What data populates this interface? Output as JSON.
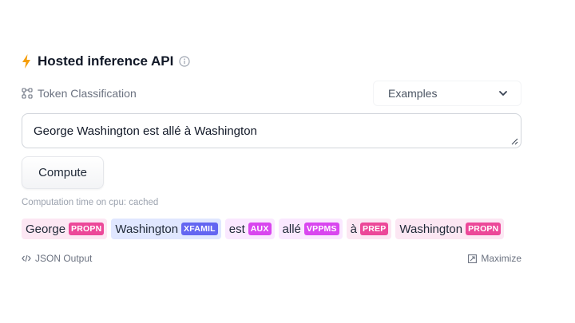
{
  "widget": {
    "title": "Hosted inference API",
    "task_label": "Token Classification",
    "examples_label": "Examples",
    "input_value": "George Washington est allé à Washington",
    "compute_label": "Compute",
    "computation_time": "Computation time on cpu: cached",
    "json_output_label": "JSON Output",
    "maximize_label": "Maximize",
    "icons": {
      "title": "lightning-icon",
      "info": "info-icon",
      "task": "token-classification-icon",
      "dropdown": "chevron-down-icon",
      "resize": "resize-handle-icon",
      "json": "code-icon",
      "maximize": "maximize-icon"
    }
  },
  "tokens": [
    {
      "word": "George",
      "label": "PROPN",
      "bg": "#fce7f3",
      "label_bg": "#ec4899",
      "text_color": "#1f2937"
    },
    {
      "word": "Washington",
      "label": "XFAMIL",
      "bg": "#e0e7ff",
      "label_bg": "#6366f1",
      "text_color": "#1f2937"
    },
    {
      "word": "est",
      "label": "AUX",
      "bg": "#fae8ff",
      "label_bg": "#d946ef",
      "text_color": "#1f2937"
    },
    {
      "word": "allé",
      "label": "VPPMS",
      "bg": "#fae8ff",
      "label_bg": "#d946ef",
      "text_color": "#1f2937"
    },
    {
      "word": "à",
      "label": "PREP",
      "bg": "#fce7f3",
      "label_bg": "#ec4899",
      "text_color": "#1f2937"
    },
    {
      "word": "Washington",
      "label": "PROPN",
      "bg": "#fce7f3",
      "label_bg": "#ec4899",
      "text_color": "#1f2937"
    }
  ],
  "colors": {
    "accent": "#f59e0b",
    "muted_text": "#6b7280",
    "border": "#d1d5db"
  }
}
